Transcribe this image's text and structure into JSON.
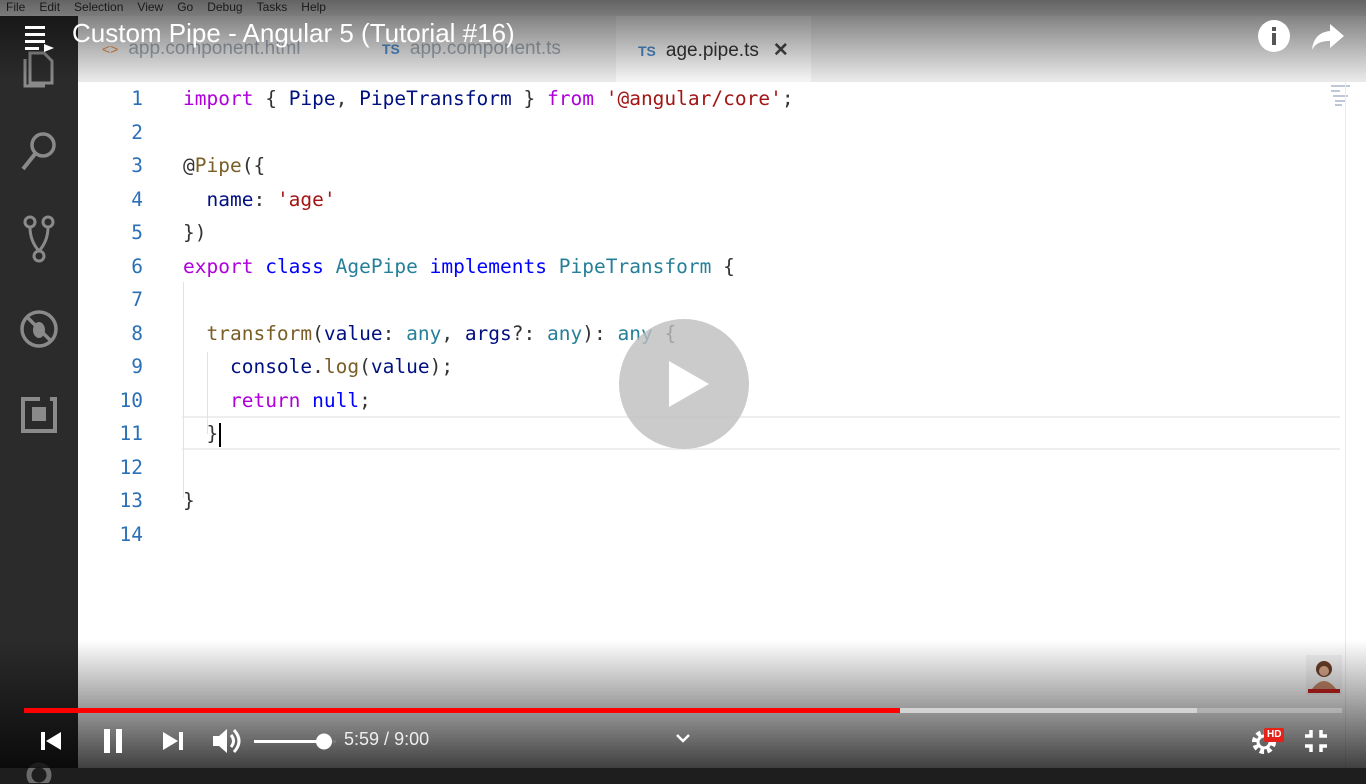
{
  "menu": [
    "File",
    "Edit",
    "Selection",
    "View",
    "Go",
    "Debug",
    "Tasks",
    "Help"
  ],
  "video": {
    "title": "Custom Pipe - Angular 5 (Tutorial #16)",
    "current_time": "5:59",
    "separator": " / ",
    "duration": "9:00",
    "played_fraction": 0.665,
    "buffered_fraction": 0.89,
    "volume_fraction": 1.0,
    "quality_badge": "HD"
  },
  "tabs": [
    {
      "icon": "<>",
      "label": "app.component.html"
    },
    {
      "icon": "TS",
      "label": "app.component.ts"
    },
    {
      "icon": "TS",
      "label": "age.pipe.ts",
      "close": "✕"
    }
  ],
  "code_lines": [
    {
      "n": "1",
      "tokens": [
        [
          "kw",
          "import"
        ],
        [
          "p",
          " { "
        ],
        [
          "vr",
          "Pipe"
        ],
        [
          "p",
          ", "
        ],
        [
          "vr",
          "PipeTransform"
        ],
        [
          "p",
          " } "
        ],
        [
          "kw",
          "from"
        ],
        [
          "p",
          " "
        ],
        [
          "st",
          "'@angular/core'"
        ],
        [
          "p",
          ";"
        ]
      ]
    },
    {
      "n": "2",
      "tokens": []
    },
    {
      "n": "3",
      "tokens": [
        [
          "p",
          "@"
        ],
        [
          "fn",
          "Pipe"
        ],
        [
          "p",
          "({"
        ]
      ]
    },
    {
      "n": "4",
      "tokens": [
        [
          "p",
          "  "
        ],
        [
          "vr",
          "name"
        ],
        [
          "p",
          ": "
        ],
        [
          "st",
          "'age'"
        ]
      ]
    },
    {
      "n": "5",
      "tokens": [
        [
          "p",
          "})"
        ]
      ]
    },
    {
      "n": "6",
      "tokens": [
        [
          "kw",
          "export"
        ],
        [
          "p",
          " "
        ],
        [
          "kb",
          "class"
        ],
        [
          "p",
          " "
        ],
        [
          "ty",
          "AgePipe"
        ],
        [
          "p",
          " "
        ],
        [
          "kb",
          "implements"
        ],
        [
          "p",
          " "
        ],
        [
          "ty",
          "PipeTransform"
        ],
        [
          "p",
          " {"
        ]
      ]
    },
    {
      "n": "7",
      "tokens": []
    },
    {
      "n": "8",
      "tokens": [
        [
          "p",
          "  "
        ],
        [
          "fn",
          "transform"
        ],
        [
          "p",
          "("
        ],
        [
          "vr",
          "value"
        ],
        [
          "p",
          ": "
        ],
        [
          "ty",
          "any"
        ],
        [
          "p",
          ", "
        ],
        [
          "vr",
          "args"
        ],
        [
          "p",
          "?: "
        ],
        [
          "ty",
          "any"
        ],
        [
          "p",
          "): "
        ],
        [
          "ty",
          "any"
        ],
        [
          "p",
          " {"
        ]
      ]
    },
    {
      "n": "9",
      "tokens": [
        [
          "p",
          "    "
        ],
        [
          "vr",
          "console"
        ],
        [
          "p",
          "."
        ],
        [
          "fn",
          "log"
        ],
        [
          "p",
          "("
        ],
        [
          "vr",
          "value"
        ],
        [
          "p",
          ");"
        ]
      ]
    },
    {
      "n": "10",
      "tokens": [
        [
          "p",
          "    "
        ],
        [
          "kw",
          "return"
        ],
        [
          "p",
          " "
        ],
        [
          "kb",
          "null"
        ],
        [
          "p",
          ";"
        ]
      ]
    },
    {
      "n": "11",
      "tokens": [
        [
          "p",
          "  }"
        ]
      ]
    },
    {
      "n": "12",
      "tokens": []
    },
    {
      "n": "13",
      "tokens": [
        [
          "p",
          "}"
        ]
      ]
    },
    {
      "n": "14",
      "tokens": []
    }
  ],
  "icons": {
    "activity": [
      "explorer-icon",
      "search-icon",
      "source-control-icon",
      "debug-icon",
      "extensions-icon",
      "settings-icon"
    ],
    "top": [
      "menu-icon",
      "info-icon",
      "share-icon"
    ],
    "controls": [
      "previous-icon",
      "pause-icon",
      "next-icon",
      "volume-icon",
      "chevron-down-icon",
      "settings-gear-icon",
      "exit-fullscreen-icon",
      "play-icon"
    ]
  },
  "colors": {
    "progress_played": "#ff0000",
    "keyword": "#af00db",
    "blue_keyword": "#0000ff",
    "type": "#267f99",
    "function": "#795e26",
    "string": "#a31515",
    "line_number": "#2b6fb6"
  }
}
